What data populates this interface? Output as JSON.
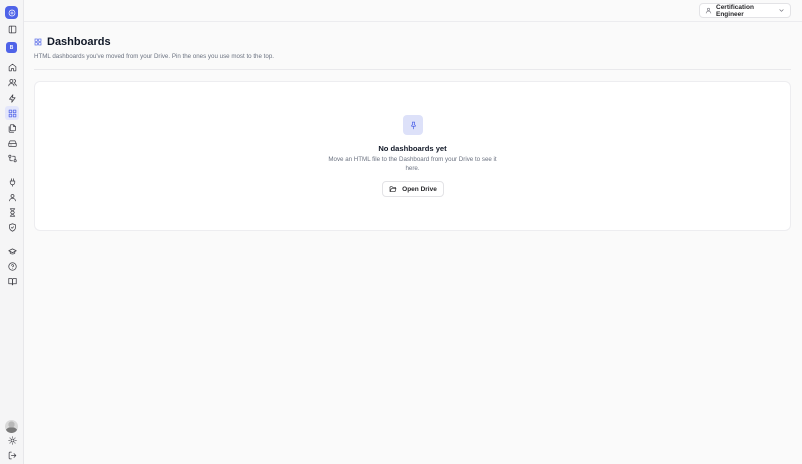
{
  "sidebar": {
    "workspace_initial": "B",
    "items": [
      {
        "name": "home",
        "icon": "home-icon"
      },
      {
        "name": "people",
        "icon": "users-icon"
      },
      {
        "name": "automations",
        "icon": "bolt-icon"
      },
      {
        "name": "dashboards",
        "icon": "grid-icon",
        "active": true
      },
      {
        "name": "files",
        "icon": "files-icon"
      },
      {
        "name": "drive",
        "icon": "drive-icon"
      },
      {
        "name": "flows",
        "icon": "git-compare-icon"
      },
      {
        "name": "integrations",
        "icon": "plug-icon"
      },
      {
        "name": "profile",
        "icon": "user-icon"
      },
      {
        "name": "tasks",
        "icon": "hourglass-icon"
      },
      {
        "name": "security",
        "icon": "shield-icon"
      },
      {
        "name": "learning",
        "icon": "graduation-cap-icon"
      },
      {
        "name": "help",
        "icon": "help-circle-icon"
      },
      {
        "name": "docs",
        "icon": "book-icon"
      }
    ]
  },
  "topbar": {
    "role_label": "Certification Engineer"
  },
  "header": {
    "title": "Dashboards",
    "subtitle": "HTML dashboards you've moved from your Drive. Pin the ones you use most to the top."
  },
  "empty_state": {
    "icon": "pin-icon",
    "title": "No dashboards yet",
    "description": "Move an HTML file to the Dashboard from your Drive to see it here.",
    "button_label": "Open Drive"
  },
  "colors": {
    "accent": "#4f63e8",
    "accent_soft": "#dde1f9"
  }
}
